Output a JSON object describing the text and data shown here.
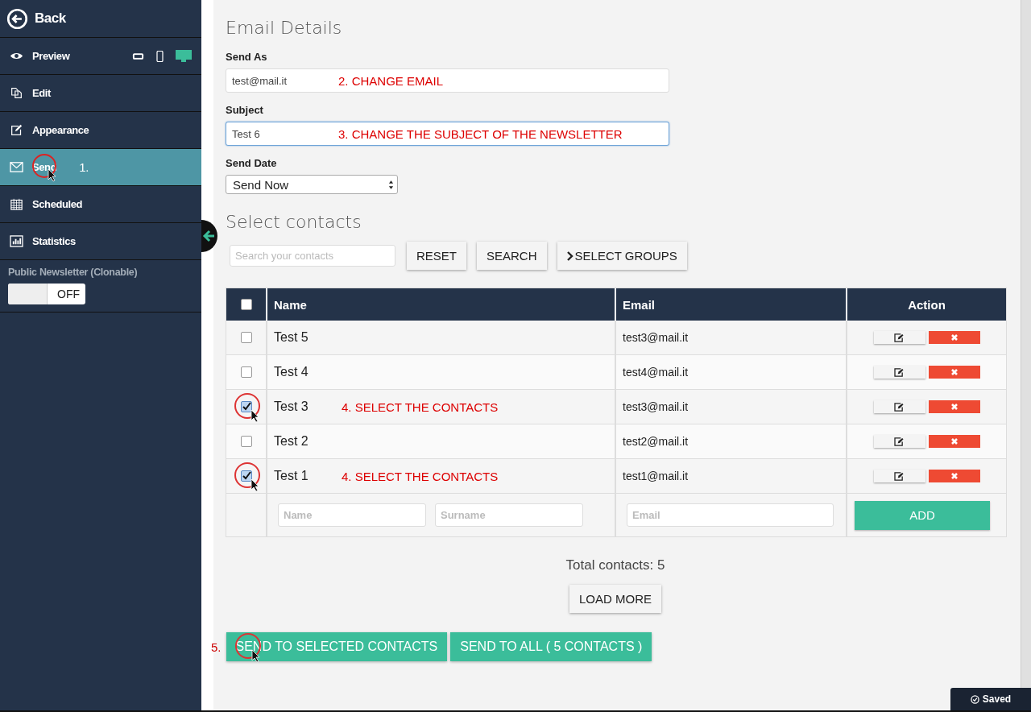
{
  "sidebar": {
    "back": "Back",
    "items": [
      {
        "kind": "preview",
        "label": "Preview",
        "selected": false
      },
      {
        "kind": "edit",
        "label": "Edit",
        "selected": false
      },
      {
        "kind": "appearance",
        "label": "Appearance",
        "selected": false
      },
      {
        "kind": "send",
        "label": "Send",
        "selected": true,
        "annotation": "1."
      },
      {
        "kind": "scheduled",
        "label": "Scheduled",
        "selected": false
      },
      {
        "kind": "statistics",
        "label": "Statistics",
        "selected": false
      }
    ],
    "preview_devices": [
      {
        "kind": "tablet",
        "selected": false
      },
      {
        "kind": "phone",
        "selected": false
      },
      {
        "kind": "desktop",
        "selected": true
      }
    ],
    "public_toggle": {
      "label": "Public Newsletter (Clonable)",
      "state": "OFF",
      "on": false
    }
  },
  "email_details": {
    "title": "Email Details",
    "send_as": {
      "label": "Send As",
      "value": "test@mail.it",
      "annotation": "2. CHANGE EMAIL"
    },
    "subject": {
      "label": "Subject",
      "value": "Test 6",
      "focused": true,
      "annotation": "3. CHANGE THE SUBJECT OF THE NEWSLETTER"
    },
    "send_date": {
      "label": "Send Date",
      "value": "Send Now"
    }
  },
  "contacts": {
    "title": "Select contacts",
    "search": {
      "placeholder": "Search your contacts"
    },
    "buttons": [
      "RESET",
      "SEARCH",
      "SELECT GROUPS"
    ],
    "table": {
      "header_checked": false,
      "columns": [
        "Name",
        "Email",
        "Action"
      ],
      "rows": [
        {
          "name": "Test 5",
          "email": "test3@mail.it",
          "checked": false
        },
        {
          "name": "Test 4",
          "email": "test4@mail.it",
          "checked": false
        },
        {
          "name": "Test 3",
          "email": "test3@mail.it",
          "checked": true,
          "annotation": "4. SELECT THE CONTACTS"
        },
        {
          "name": "Test 2",
          "email": "test2@mail.it",
          "checked": false
        },
        {
          "name": "Test 1",
          "email": "test1@mail.it",
          "checked": true,
          "annotation": "4. SELECT THE CONTACTS"
        }
      ],
      "add_row": {
        "name_placeholder": "Name",
        "surname_placeholder": "Surname",
        "email_placeholder": "Email",
        "button": "ADD"
      }
    },
    "total": "Total contacts: 5",
    "load_more": "LOAD MORE"
  },
  "send": {
    "step": "5.",
    "buttons": [
      "SEND TO SELECTED CONTACTS",
      "SEND TO ALL ( 5 CONTACTS )"
    ]
  },
  "status": {
    "saved": "Saved"
  }
}
